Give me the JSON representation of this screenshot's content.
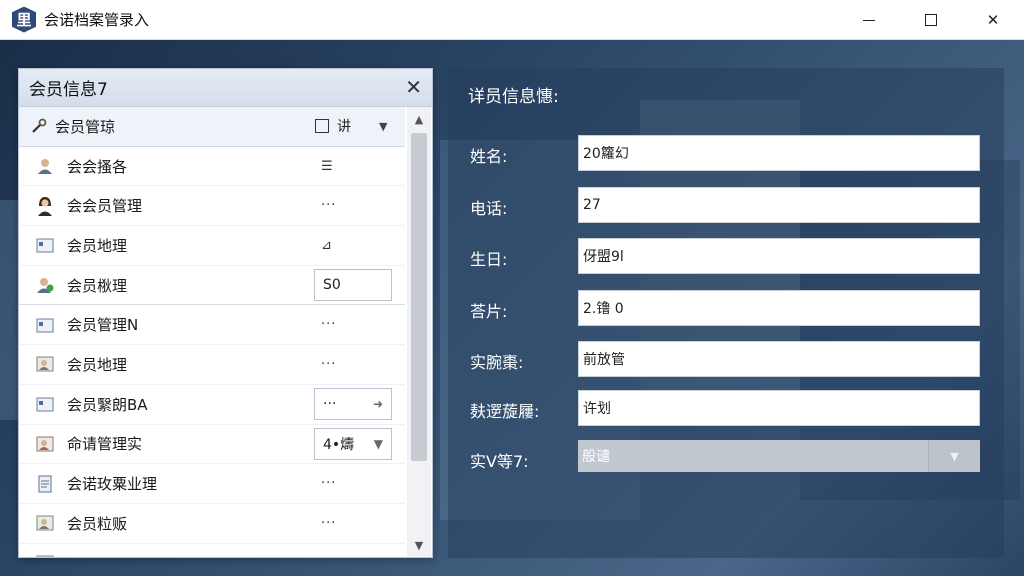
{
  "window": {
    "logo_text": "里",
    "title": "会诺档案管录入",
    "close_glyph": "✕"
  },
  "left_panel": {
    "title": "会员信息7",
    "close_glyph": "✕",
    "header_item": {
      "icon": "wrench-icon",
      "label": "会员管琼",
      "action_label": "讲",
      "dropdown_glyph": "▼"
    },
    "items": [
      {
        "icon": "user-icon",
        "label": "会会搔各",
        "action": "☰"
      },
      {
        "icon": "female-user-icon",
        "label": "会会员管理",
        "action": "···"
      },
      {
        "icon": "card-icon",
        "label": "会员地理",
        "action": "⊿"
      },
      {
        "icon": "user-check-icon",
        "label": "会员梑理",
        "box_value": "S0"
      },
      {
        "icon": "card-icon",
        "label": "会员管理N",
        "action": "···"
      },
      {
        "icon": "user-card-icon",
        "label": "会员地理",
        "action": "···"
      },
      {
        "icon": "card-icon",
        "label": "会员繄朗BA",
        "box_value": "···",
        "box_arrow": "➜"
      },
      {
        "icon": "user-card-icon",
        "label": "命请管理实",
        "box_value": "4•燽",
        "box_arrow": "▼"
      },
      {
        "icon": "document-icon",
        "label": "会诺玫粟业理",
        "action": "···"
      },
      {
        "icon": "user-card-icon",
        "label": "会员粒贩",
        "action": "···"
      }
    ],
    "scroll_up_glyph": "▲",
    "scroll_down_glyph": "▼"
  },
  "right_panel": {
    "title": "详员信息憓:",
    "fields": [
      {
        "label": "姓名:",
        "value": "20籮幻"
      },
      {
        "label": "电话:",
        "value": "27"
      },
      {
        "label": "生日:",
        "value": "伢盟9l"
      },
      {
        "label": "荅片:",
        "value": "2.镥 0"
      },
      {
        "label": "实腕棗:",
        "value": "前放管"
      },
      {
        "label": "麸遻蔙屨:",
        "value": "许划"
      }
    ],
    "select": {
      "label": "实V等7:",
      "value": "般谴",
      "dropdown_glyph": "▼"
    }
  },
  "colors": {
    "accent": "#2f4a78",
    "panel_header": "#dbe4f0",
    "background": "#2a4566"
  }
}
